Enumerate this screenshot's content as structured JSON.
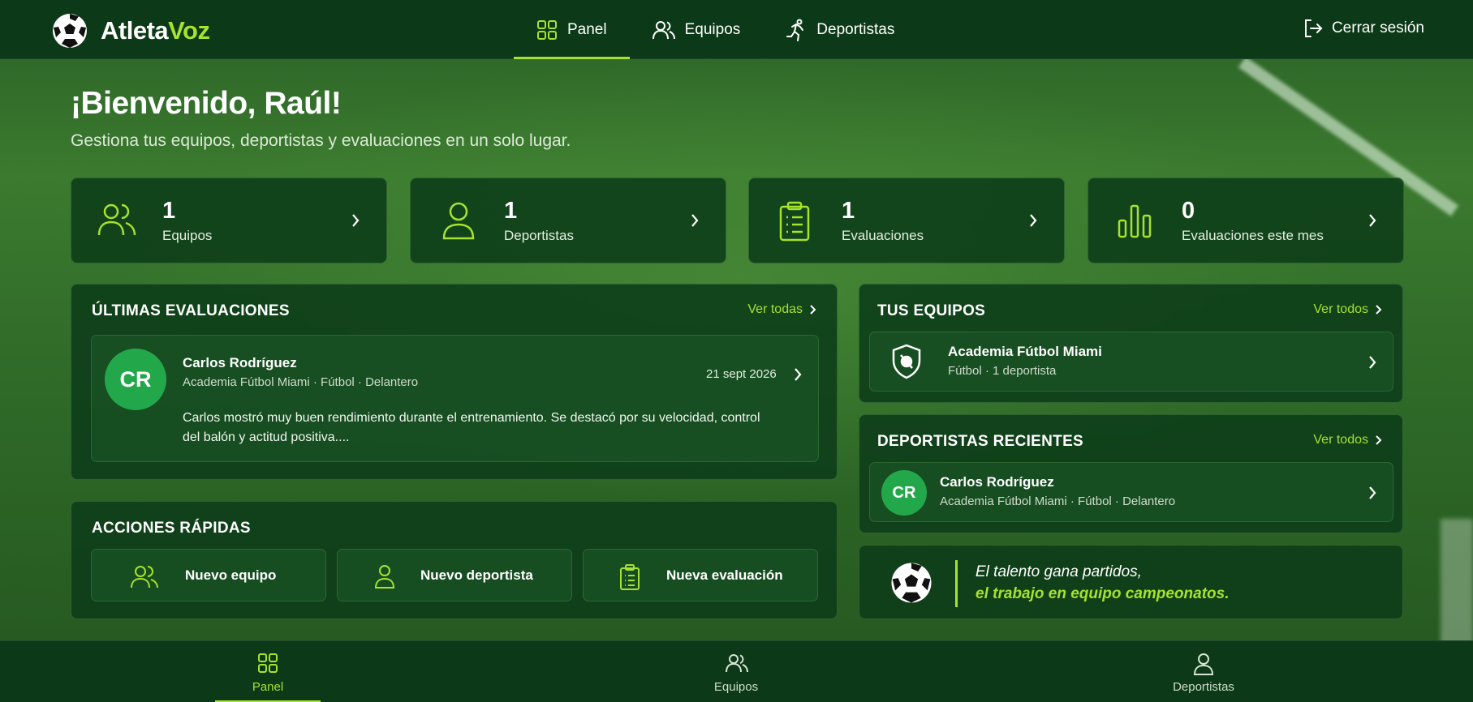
{
  "brand": {
    "part1": "Atleta",
    "part2": "Voz"
  },
  "nav": [
    {
      "label": "Panel",
      "icon": "grid-icon",
      "active": true
    },
    {
      "label": "Equipos",
      "icon": "users-icon"
    },
    {
      "label": "Deportistas",
      "icon": "runner-icon"
    }
  ],
  "logout_label": "Cerrar sesión",
  "welcome": "¡Bienvenido, Raúl!",
  "subtitle": "Gestiona tus equipos, deportistas y evaluaciones en un solo lugar.",
  "stats": [
    {
      "value": "1",
      "label": "Equipos",
      "icon": "users-icon"
    },
    {
      "value": "1",
      "label": "Deportistas",
      "icon": "user-icon"
    },
    {
      "value": "1",
      "label": "Evaluaciones",
      "icon": "clipboard-icon"
    },
    {
      "value": "0",
      "label": "Evaluaciones este mes",
      "icon": "bar-chart-icon"
    }
  ],
  "evaluations": {
    "title": "ÚLTIMAS EVALUACIONES",
    "see_all": "Ver todas",
    "item": {
      "initials": "CR",
      "name": "Carlos Rodríguez",
      "meta": "Academia Fútbol Miami · Fútbol · Delantero",
      "date": "21 sept 2026",
      "comment_line1": "Carlos mostró muy buen rendimiento durante el entrenamiento. Se destacó por su velocidad, control",
      "comment_line2": "del balón y actitud positiva...."
    }
  },
  "teams": {
    "title": "TUS EQUIPOS",
    "see_all": "Ver todos",
    "item": {
      "name": "Academia Fútbol Miami",
      "meta": "Fútbol · 1 deportista",
      "icon": "shield-icon"
    }
  },
  "athletes": {
    "title": "DEPORTISTAS RECIENTES",
    "see_all": "Ver todos",
    "item": {
      "initials": "CR",
      "name": "Carlos Rodríguez",
      "meta": "Academia Fútbol Miami · Fútbol · Delantero"
    }
  },
  "quick_actions": {
    "title": "ACCIONES RÁPIDAS",
    "actions": [
      {
        "label": "Nuevo equipo",
        "icon": "users-icon"
      },
      {
        "label": "Nuevo deportista",
        "icon": "user-icon"
      },
      {
        "label": "Nueva evaluación",
        "icon": "clipboard-icon"
      }
    ]
  },
  "quote": {
    "line1": "El talento gana partidos,",
    "line2": "el trabajo en equipo campeonatos."
  },
  "bottom_nav": [
    {
      "label": "Panel",
      "icon": "grid-icon",
      "active": true
    },
    {
      "label": "Equipos",
      "icon": "users-icon"
    },
    {
      "label": "Deportistas",
      "icon": "user-icon"
    }
  ],
  "colors": {
    "accent": "#a6e22e",
    "panel": "#0c3c19",
    "avatar": "#22a84a",
    "nav_bg": "#0c3a18"
  }
}
